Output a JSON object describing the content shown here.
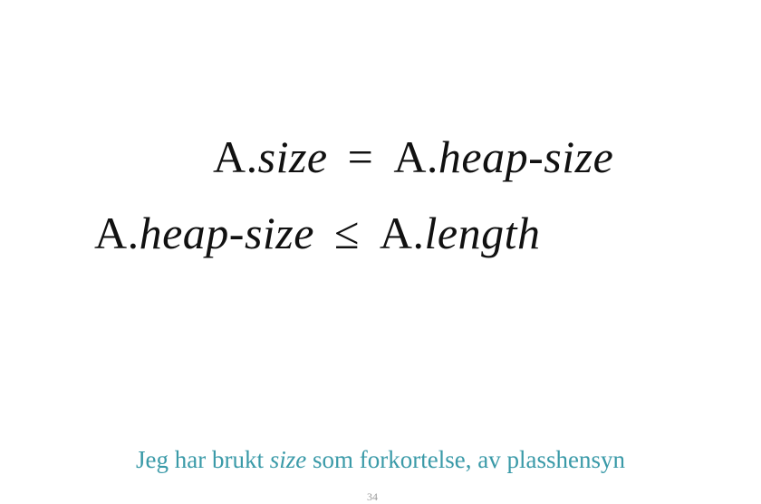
{
  "equations": {
    "line1": {
      "lhs_object": "A.",
      "lhs_attr": "size",
      "relation": "=",
      "rhs_object": "A.",
      "rhs_attr": "heap-size"
    },
    "line2": {
      "lhs_object": "A.",
      "lhs_attr": "heap-size",
      "relation": "≤",
      "rhs_object": "A.",
      "rhs_attr": "length"
    }
  },
  "note": {
    "before": "Jeg har brukt ",
    "emphasis": "size",
    "after": " som forkortelse, av plasshensyn"
  },
  "colors": {
    "text": "#111111",
    "note": "#3a9aa8"
  },
  "page_number": "34"
}
